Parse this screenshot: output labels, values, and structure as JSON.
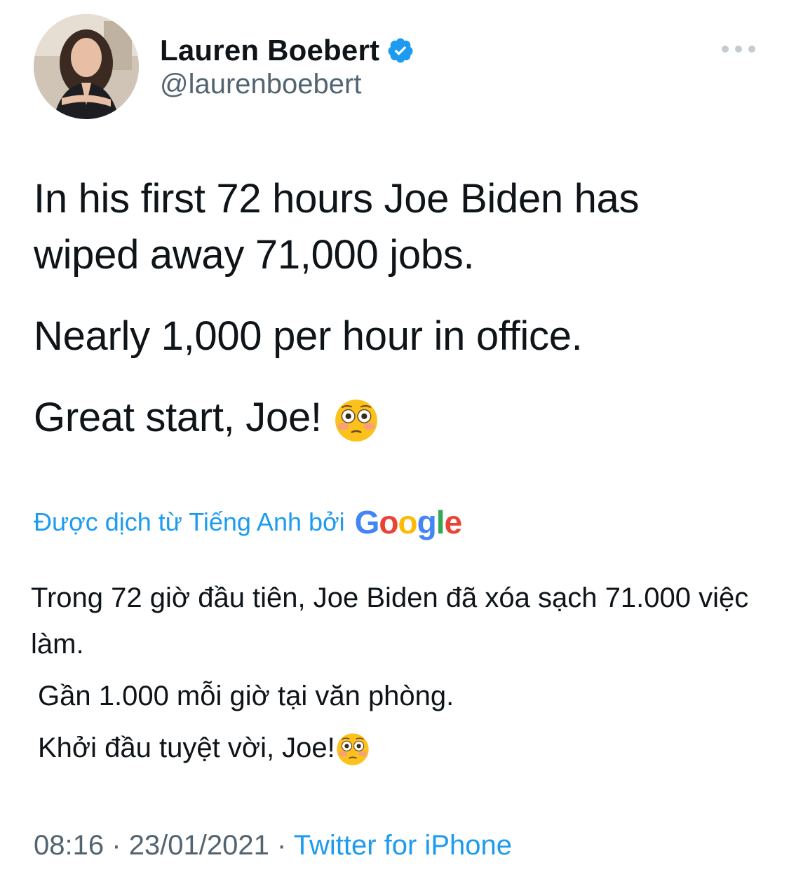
{
  "author": {
    "name": "Lauren Boebert",
    "handle": "@laurenboebert",
    "verified": true
  },
  "tweet": {
    "paragraphs": [
      "In his first 72 hours Joe Biden has wiped away 71,000 jobs.",
      "Nearly 1,000 per hour in office.",
      "Great start, Joe!"
    ],
    "emoji": "flushed-face-emoji"
  },
  "translation": {
    "label": "Được dịch từ Tiếng Anh bởi",
    "provider_letters": [
      "G",
      "o",
      "o",
      "g",
      "l",
      "e"
    ],
    "paragraphs": [
      "Trong 72 giờ đầu tiên, Joe Biden đã xóa sạch 71.000 việc làm.",
      "Gần 1.000 mỗi giờ tại văn phòng.",
      "Khởi đầu tuyệt vời, Joe!"
    ]
  },
  "meta": {
    "time": "08:16",
    "separator": "·",
    "date": "23/01/2021",
    "source": "Twitter for iPhone"
  },
  "colors": {
    "link_blue": "#1d9bf0",
    "secondary_text": "#536471",
    "primary_text": "#0f1419"
  }
}
